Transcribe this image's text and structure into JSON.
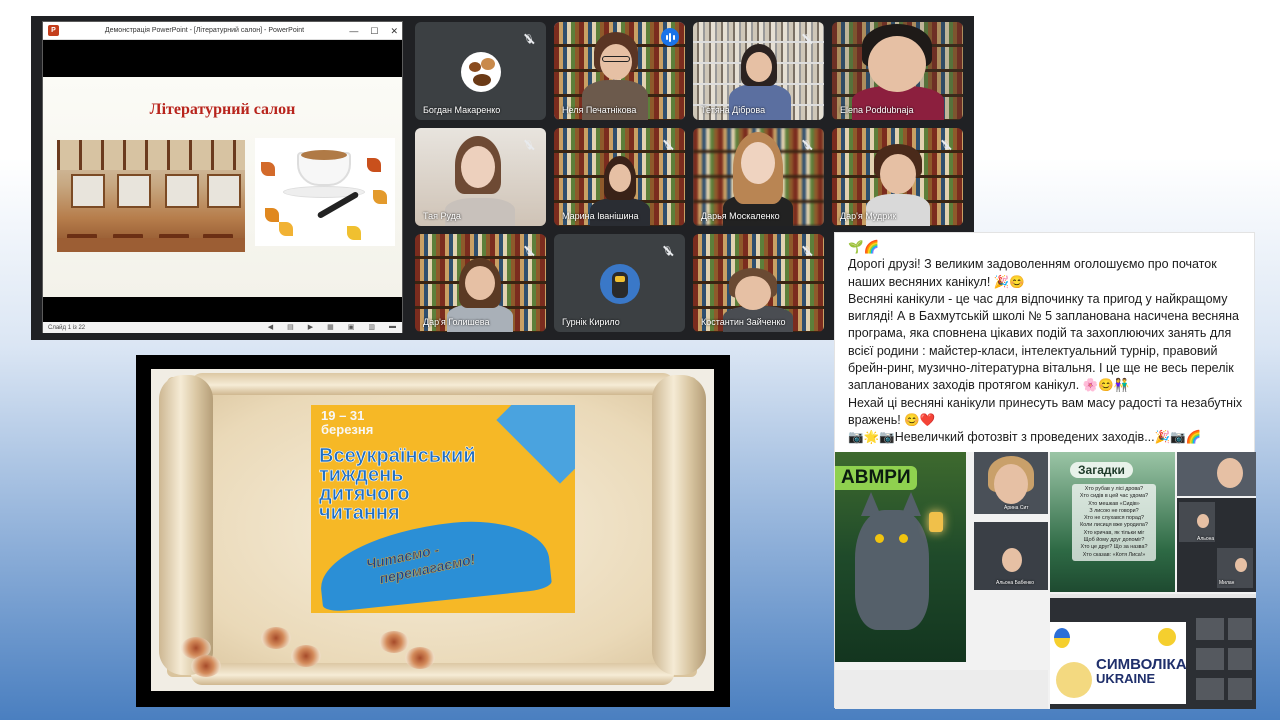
{
  "powerpoint": {
    "window_title": "Демонстрація PowerPoint - [Літературний салон] - PowerPoint",
    "slide_title": "Літературний салон",
    "status_slide": "Слайд 1 із 22"
  },
  "participants": [
    {
      "name": "Богдан Макаренко",
      "muted": true
    },
    {
      "name": "Неля Печатнікова",
      "speaking": true
    },
    {
      "name": "Тетяна Діброва",
      "muted": true
    },
    {
      "name": "Elena Poddubnaja",
      "muted": false
    },
    {
      "name": "Тая Руда",
      "muted": true
    },
    {
      "name": "Марина Іванішина",
      "muted": true
    },
    {
      "name": "Дарья Москаленко",
      "muted": true
    },
    {
      "name": "Дар'я Мудрик",
      "muted": true
    },
    {
      "name": "Дар'я Голишева",
      "muted": true
    },
    {
      "name": "Гурнік Кирило",
      "muted": true
    },
    {
      "name": "Костантин Зайченко",
      "muted": true
    }
  ],
  "post": {
    "line0": "🌱🌈",
    "p1": "Дорогі друзі! З великим задоволенням оголошуємо про початок наших весняних канікул! 🎉😊",
    "p2": "Весняні канікули - це час для відпочинку та пригод у найкращому вигляді! А в Бахмутській школі № 5 запланована насичена весняна програма, яка сповнена цікавих подій та захоплюючих занять для всієї родини : майстер-класи, інтелектуальний турнір, правовий брейн-ринг, музично-літературна вітальня. І це ще не весь перелік запланованих заходів протягом канікул. 🌸😊👫",
    "p3": "Нехай ці весняні канікули принесуть вам масу радості та незабутніх вражень! 😊❤️",
    "p4": "📷🌟📷Невеличкий фотозвіт з проведених заходів...🎉📷🌈"
  },
  "photos": {
    "wolf_title": "АВМРИ",
    "riddle_title": "Загадки",
    "riddle_lines": [
      "Хто рубав у лісі дрова?",
      "Хто сидів в цей час удома?",
      "Хто мешкав «Сидів»",
      "З лисою не говори?",
      "Хто не слухався порад?",
      "Коли лисиця вже уродила?",
      "Хто кричав, як тільки міг",
      "Щоб йому друг допоміг?",
      "Хто це друг? Що за назва?",
      "Хто сказав: «Котя Лиса!»"
    ],
    "name1": "Арина Сит",
    "name2": "Альона Бабенко",
    "name3": "Альона",
    "name4": "Милан",
    "symbol_line1": "СИМВОЛІКА",
    "symbol_line2": "UKRAINE",
    "name5": "Ма"
  },
  "poster": {
    "dates_line1": "19 – 31",
    "dates_line2": "березня",
    "title_line1": "Всеукраїнський",
    "title_line2": "тиждень",
    "title_line3": "дитячого",
    "title_line4": "читання",
    "slogan_line1": "Читаємо -",
    "slogan_line2": "перемагаємо!"
  }
}
